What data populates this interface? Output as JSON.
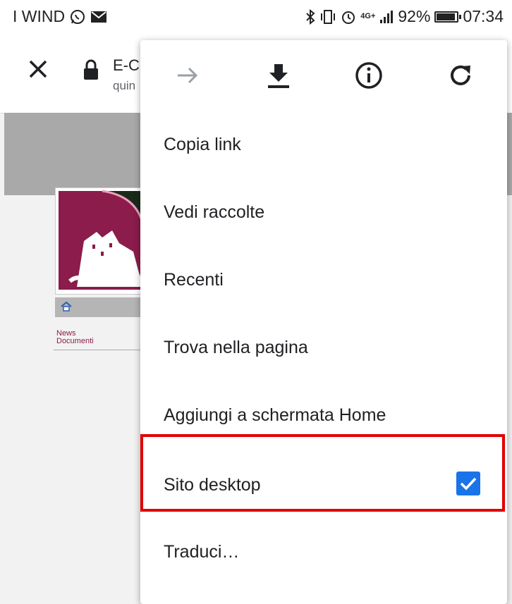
{
  "status_bar": {
    "carrier": "I WIND",
    "network": "4G+",
    "battery_percent": "92%",
    "battery_level": 0.92,
    "time": "07:34"
  },
  "browser": {
    "page_title": "E-C",
    "page_subtitle": "quin"
  },
  "website": {
    "links": [
      "News",
      "Documenti"
    ]
  },
  "menu": {
    "top_icons": [
      "forward-icon",
      "download-icon",
      "info-icon",
      "refresh-icon"
    ],
    "items": [
      {
        "label": "Copia link"
      },
      {
        "label": "Vedi raccolte"
      },
      {
        "label": "Recenti"
      },
      {
        "label": "Trova nella pagina"
      },
      {
        "label": "Aggiungi a schermata Home"
      },
      {
        "label": "Sito desktop",
        "checked": true
      },
      {
        "label": "Traduci…"
      }
    ]
  },
  "colors": {
    "checkbox": "#1a73e8",
    "highlight": "#e00000",
    "site_accent": "#8b1c4b"
  }
}
